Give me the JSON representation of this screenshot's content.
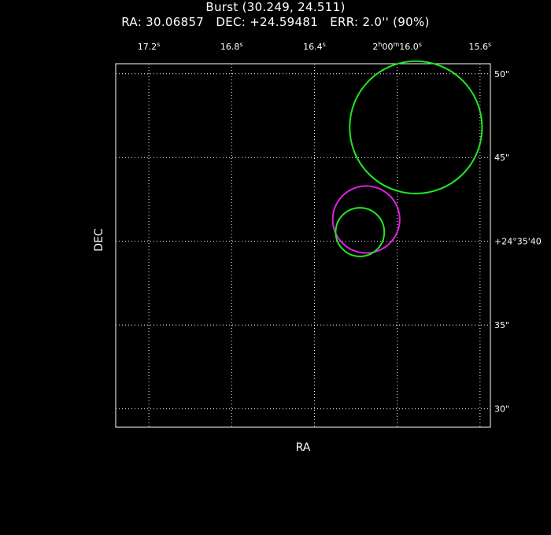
{
  "header": {
    "title": "Burst (30.249, 24.511)",
    "ra_label": "RA:",
    "ra_value": "30.06857",
    "dec_label": "DEC:",
    "dec_value": "+24.59481",
    "err_label": "ERR:",
    "err_value": "2.0'' (90%)"
  },
  "chart_data": {
    "type": "scatter",
    "xlabel": "RA",
    "ylabel": "DEC",
    "x_ticks": [
      {
        "label": "17.2s",
        "value": 17.2
      },
      {
        "label": "16.8s",
        "value": 16.8
      },
      {
        "label": "16.4s",
        "value": 16.4
      },
      {
        "label": "2h00m16.0s",
        "value": 16.0
      },
      {
        "label": "15.6s",
        "value": 15.6
      }
    ],
    "y_ticks": [
      {
        "label": "50\"",
        "value": 50
      },
      {
        "label": "45\"",
        "value": 45
      },
      {
        "label": "+24°35'40",
        "value": 40
      },
      {
        "label": "35\"",
        "value": 35
      },
      {
        "label": "30\"",
        "value": 30
      }
    ],
    "xlim": [
      17.36,
      15.55
    ],
    "ylim": [
      28.9,
      50.6
    ],
    "grid": true,
    "series": [
      {
        "ra_s": 15.91,
        "dec_arcsec": 46.8,
        "radius_arcsec": 3.95,
        "color": "#22e622"
      },
      {
        "ra_s": 16.15,
        "dec_arcsec": 41.3,
        "radius_arcsec": 2.0,
        "color": "#e020e0"
      },
      {
        "ra_s": 16.18,
        "dec_arcsec": 40.55,
        "radius_arcsec": 1.45,
        "color": "#22e622"
      }
    ]
  }
}
